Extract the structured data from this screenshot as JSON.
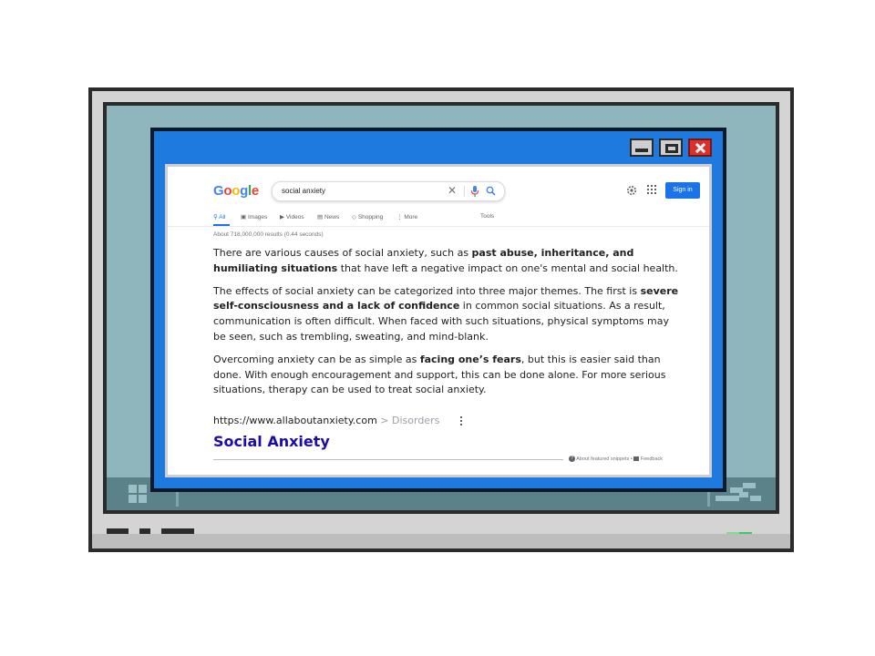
{
  "google": {
    "logo_letters": [
      "G",
      "o",
      "o",
      "g",
      "l",
      "e"
    ],
    "search_query": "social anxiety",
    "signin_label": "Sign in",
    "tabs": [
      {
        "label": "All",
        "icon": "search-icon"
      },
      {
        "label": "Images",
        "icon": "image-icon"
      },
      {
        "label": "Videos",
        "icon": "video-icon"
      },
      {
        "label": "News",
        "icon": "news-icon"
      },
      {
        "label": "Shopping",
        "icon": "tag-icon"
      },
      {
        "label": "More",
        "icon": "more-vertical-icon"
      },
      {
        "label": "Tools"
      }
    ],
    "result_stats": "About 718,000,000 results (0.44 seconds)"
  },
  "snippet": {
    "p1": {
      "pre": "There are various causes of social anxiety, such as ",
      "bold": "past abuse, inheritance, and humiliating situations",
      "post": " that have left a negative impact on one's mental and social health."
    },
    "p2": {
      "pre": "The effects of social anxiety can be categorized into three major themes. The first is ",
      "bold": "severe self-consciousness and a lack of confidence",
      "post": " in common social situations. As a result, communication is often difficult. When faced with such situations, physical symptoms may be seen, such as trembling, sweating, and mind-blank."
    },
    "p3": {
      "pre": "Overcoming anxiety can be as simple as ",
      "bold": "facing one’s fears",
      "post": ", but this is easier said than done. With enough encouragement and support, this can be done alone. For more serious situations, therapy can be used to treat social anxiety."
    },
    "source_url": "https://www.allaboutanxiety.com",
    "source_crumb": " > Disorders",
    "title": "Social Anxiety",
    "about_label": "About featured snippets",
    "feedback_label": "Feedback"
  },
  "colors": {
    "window_blue": "#1f7ae0",
    "screen_teal": "#8fb6bd",
    "close_red": "#d9302b",
    "link_blue": "#1a0dab",
    "led_green": "#47c46b"
  }
}
